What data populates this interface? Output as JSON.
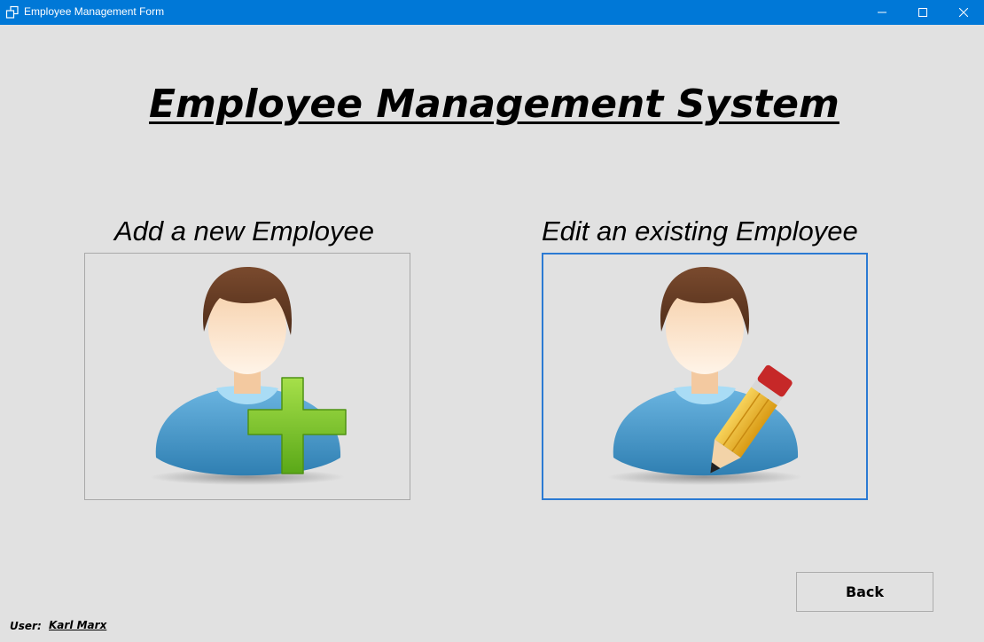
{
  "window": {
    "title": "Employee Management Form",
    "accent_color": "#0078d7",
    "icons": [
      "app-icon",
      "minimize-icon",
      "maximize-icon",
      "close-icon"
    ]
  },
  "main": {
    "title": "Employee Management System",
    "options": [
      {
        "label": "Add a new Employee",
        "icon": "add-user-icon"
      },
      {
        "label": "Edit an existing Employee",
        "icon": "edit-user-icon"
      }
    ]
  },
  "footer": {
    "back_label": "Back",
    "user_label": "User:",
    "user_name": "Karl Marx"
  }
}
